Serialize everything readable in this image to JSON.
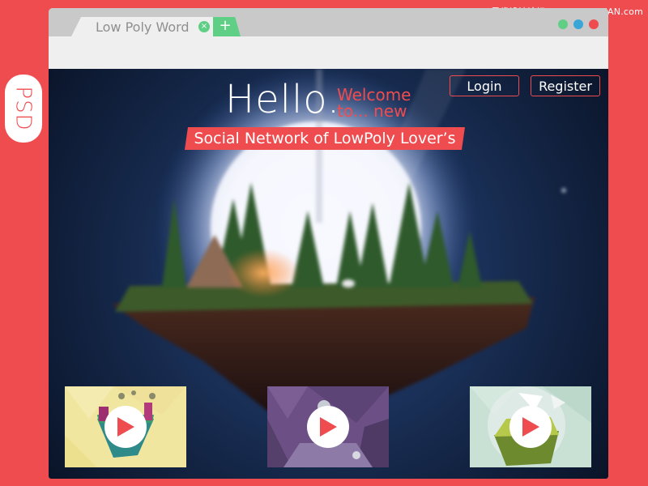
{
  "watermark": "思缘设计论坛 www.MISSYUAN.com",
  "badge": {
    "label": "PSD"
  },
  "browser": {
    "tab_title": "Low Poly Word",
    "close_glyph": "×",
    "new_tab_glyph": "+",
    "window_dots": [
      "#5fcf86",
      "#3aa6d8",
      "#ef4c50"
    ]
  },
  "header": {
    "hello": "Hello.",
    "welcome": "Welcome",
    "welcome_line2": "to... new",
    "subtitle": "Social Network of LowPoly Lover’s",
    "login_label": "Login",
    "register_label": "Register"
  },
  "thumbnails": [
    {
      "name": "yellow-island-video",
      "bg": "#f1e6a0"
    },
    {
      "name": "purple-cave-video",
      "bg": "#6b4f85"
    },
    {
      "name": "green-globe-video",
      "bg": "#c9e0d5"
    }
  ],
  "colors": {
    "accent": "#ef4c50",
    "tab_green": "#5fcf86",
    "window_bg": "#f0eff0",
    "tabbar_bg": "#c9c9c9"
  }
}
